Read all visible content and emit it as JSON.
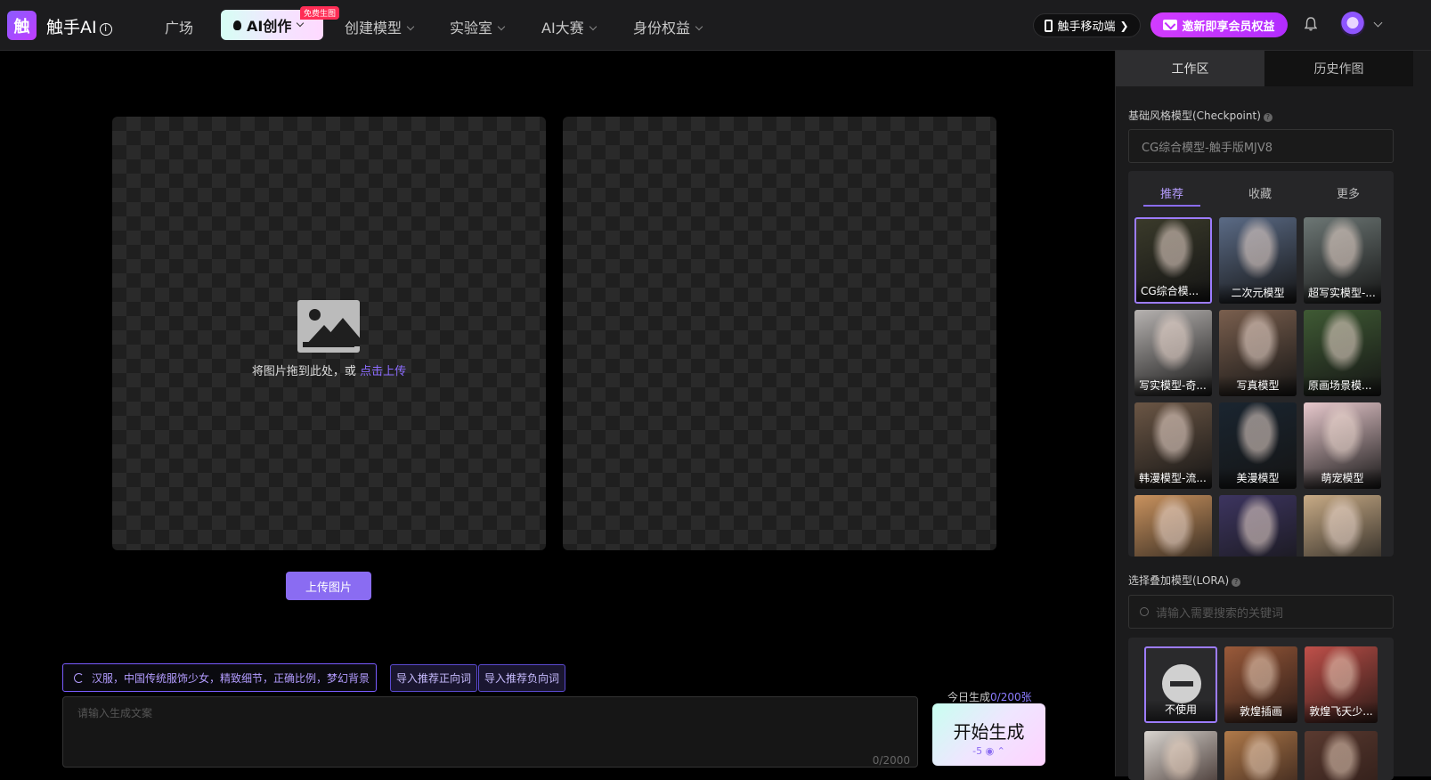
{
  "header": {
    "logo_char": "触",
    "brand": "触手AI",
    "brand_info": "i",
    "nav": [
      "广场",
      "AI创作",
      "创建模型",
      "实验室",
      "AI大赛",
      "身份权益"
    ],
    "free_badge": "免费生图",
    "mobile_label": "触手移动端",
    "vip_label": "邀新即享会员权益"
  },
  "upload": {
    "drop_text": "将图片拖到此处，或",
    "drop_link": "点击上传",
    "button_label": "上传图片"
  },
  "prompt": {
    "suggestion": "汉服，中国传统服饰少女，精致细节，正确比例，梦幻背景",
    "import_positive": "导入推荐正向词",
    "import_negative": "导入推荐负向词",
    "placeholder": "请输入生成文案",
    "counter": "0/2000"
  },
  "generate": {
    "daily_label": "今日生成",
    "daily_count": "0/200张",
    "button_label": "开始生成",
    "cost": "-5"
  },
  "panel": {
    "tabs": [
      "工作区",
      "历史作图"
    ],
    "checkpoint_label": "基础风格模型(Checkpoint)",
    "checkpoint_value": "CG综合模型-触手版MJV8",
    "model_tabs": [
      "推荐",
      "收藏",
      "更多"
    ],
    "models": [
      {
        "name": "CG综合模...",
        "color": "#3a3a2a"
      },
      {
        "name": "二次元模型",
        "color": "#5b6b86"
      },
      {
        "name": "超写实模型-...",
        "color": "#6d7775"
      },
      {
        "name": "写实模型-奇...",
        "color": "#b6b2b0"
      },
      {
        "name": "写真模型",
        "color": "#7a5f4e"
      },
      {
        "name": "原画场景模...",
        "color": "#3f5a34"
      },
      {
        "name": "韩漫模型-流...",
        "color": "#6b5645"
      },
      {
        "name": "美漫模型",
        "color": "#1a2530"
      },
      {
        "name": "萌宠模型",
        "color": "#e8c9cd"
      },
      {
        "name": "",
        "color": "#c9925e"
      },
      {
        "name": "",
        "color": "#3d3560"
      },
      {
        "name": "",
        "color": "#c8ab86"
      }
    ],
    "lora_label": "选择叠加模型(LORA)",
    "lora_search_placeholder": "请输入需要搜索的关键词",
    "loras": [
      {
        "name": "不使用",
        "color": "#2a2a2c"
      },
      {
        "name": "敦煌插画",
        "color": "#9a5a3a"
      },
      {
        "name": "敦煌飞天少...",
        "color": "#c0504a"
      },
      {
        "name": "",
        "color": "#d9d5d0"
      },
      {
        "name": "",
        "color": "#b07a4a"
      },
      {
        "name": "",
        "color": "#5a3a30"
      }
    ]
  }
}
